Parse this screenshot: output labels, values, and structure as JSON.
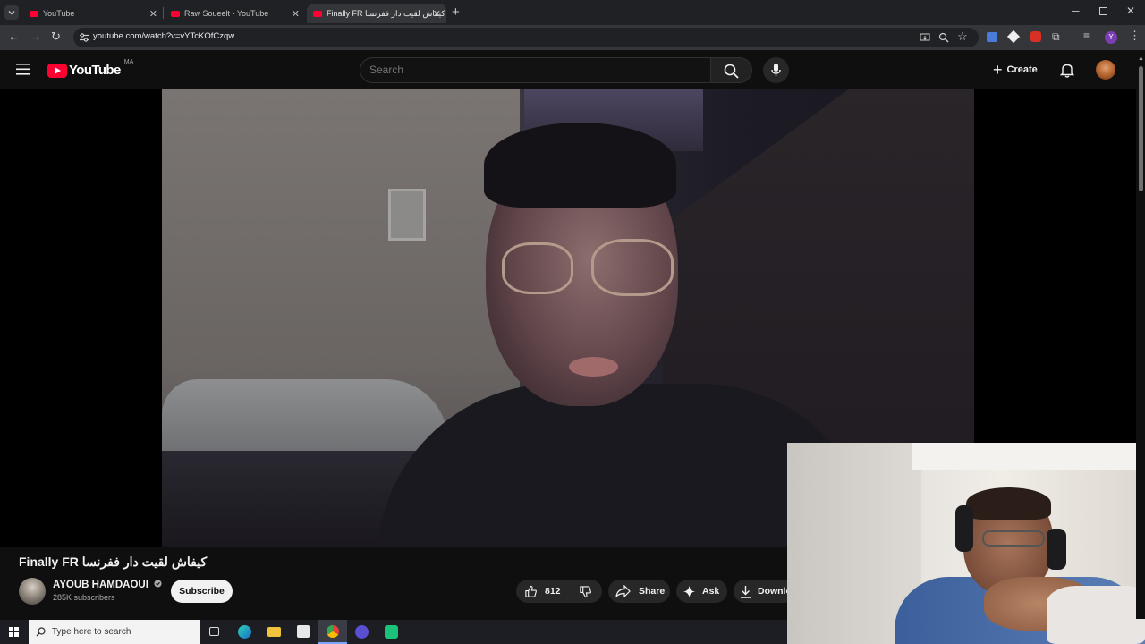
{
  "browser": {
    "tabs": [
      {
        "label": "YouTube",
        "active": false
      },
      {
        "label": "Raw Soueelt - YouTube",
        "active": false
      },
      {
        "label": "Finally FR كيفاش لقيت دار ففرنسا",
        "active": true
      }
    ],
    "url": "youtube.com/watch?v=vYTcKOfCzqw"
  },
  "youtube": {
    "logo_text": "YouTube",
    "region": "MA",
    "search_placeholder": "Search",
    "create_label": "Create"
  },
  "video": {
    "title_prefix": "Finally FR",
    "title_arabic": "كيفاش لقيت دار ففرنسا",
    "channel_name": "AYOUB HAMDAOUI",
    "subscribers": "285K subscribers",
    "subscribe_label": "Subscribe",
    "likes": "812",
    "share_label": "Share",
    "ask_label": "Ask",
    "download_label": "Downlo"
  },
  "taskbar": {
    "search_placeholder": "Type here to search"
  },
  "colors": {
    "yt_red": "#ff0033",
    "background": "#0f0f0f",
    "pill": "#272727"
  }
}
